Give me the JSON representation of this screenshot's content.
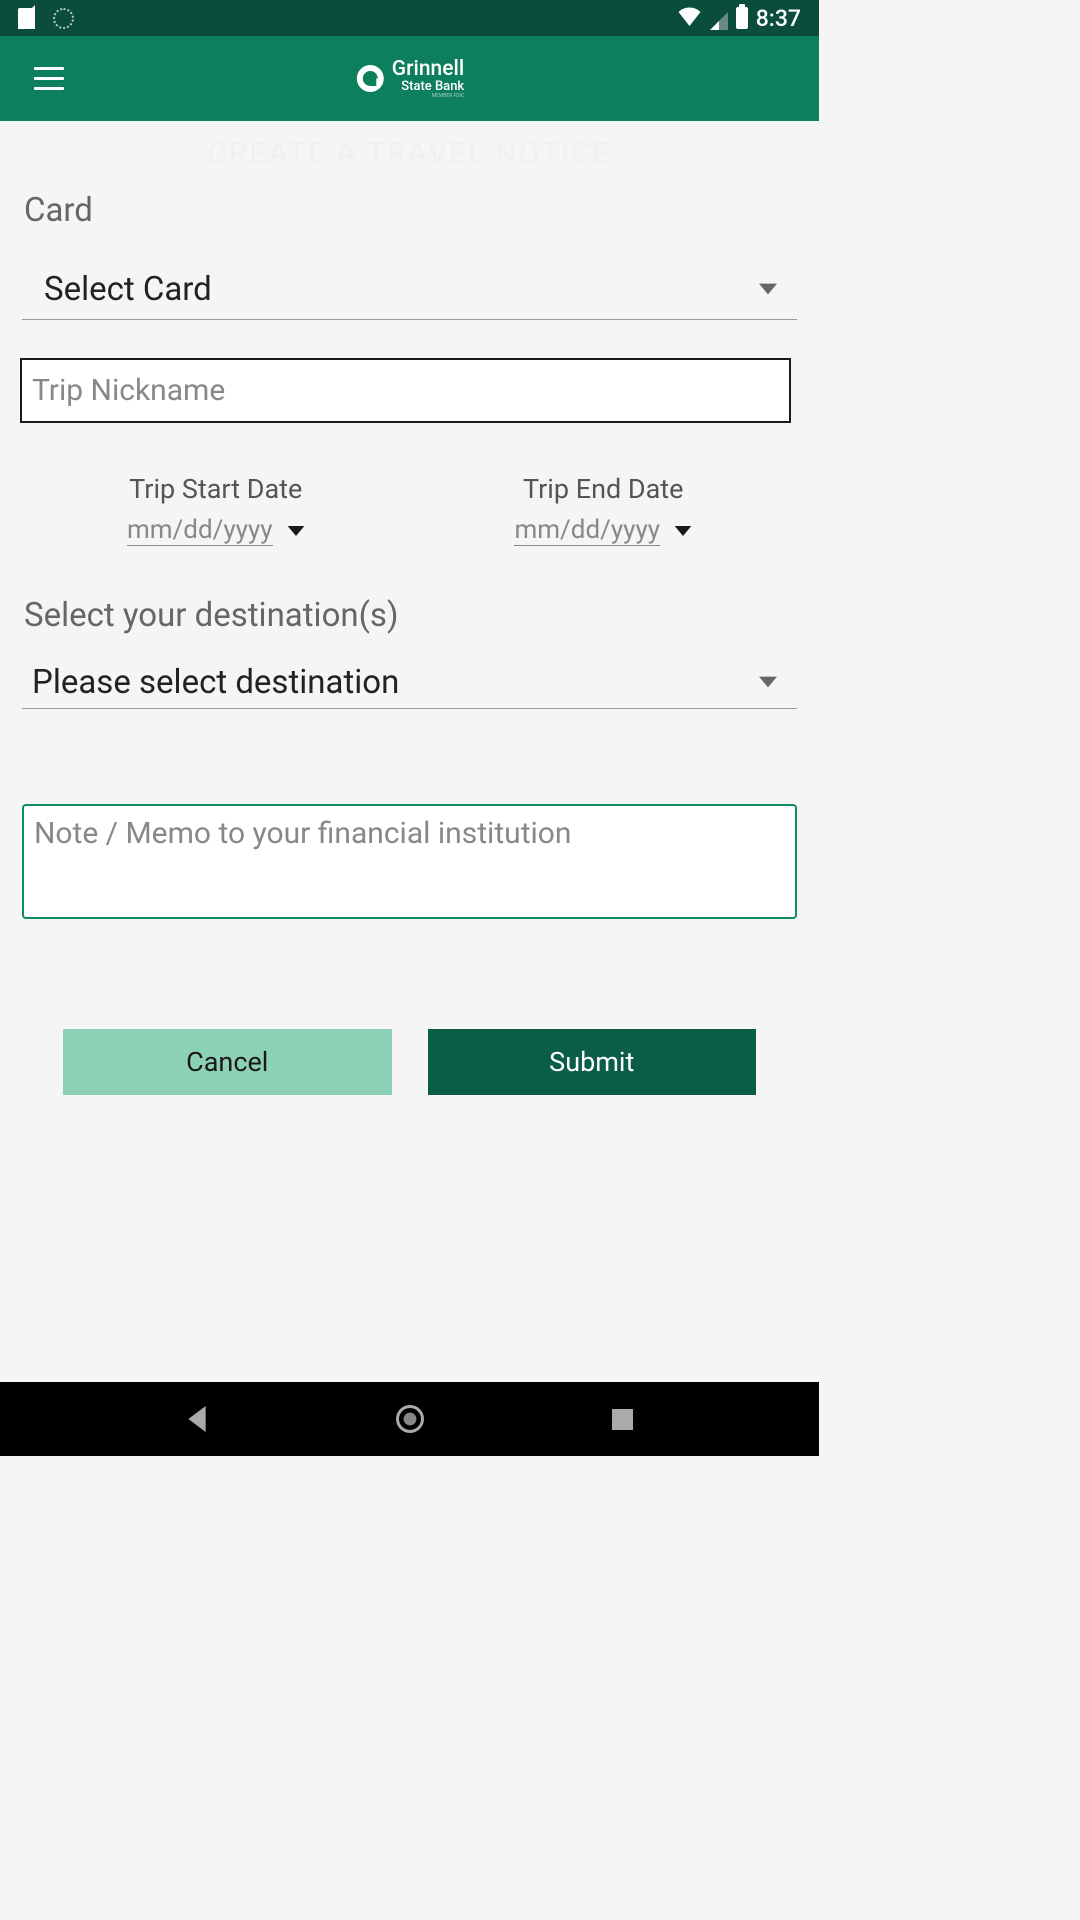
{
  "status_bar": {
    "time": "8:37"
  },
  "header": {
    "brand_line1": "Grinnell",
    "brand_line2": "State Bank",
    "brand_line3": "MEMBER FDIC"
  },
  "page": {
    "title": "CREATE A TRAVEL NOTICE"
  },
  "card_section": {
    "label": "Card",
    "select_placeholder": "Select Card"
  },
  "trip_nickname": {
    "placeholder": "Trip Nickname",
    "value": ""
  },
  "dates": {
    "start_label": "Trip Start Date",
    "start_value": "mm/dd/yyyy",
    "end_label": "Trip End Date",
    "end_value": "mm/dd/yyyy"
  },
  "destination": {
    "label": "Select your destination(s)",
    "select_placeholder": "Please select destination"
  },
  "memo": {
    "placeholder": "Note / Memo to your financial institution",
    "value": ""
  },
  "buttons": {
    "cancel": "Cancel",
    "submit": "Submit"
  },
  "colors": {
    "status_bg": "#0a4d3c",
    "header_bg": "#0e7f5d",
    "accent": "#0e8c64",
    "submit_bg": "#0a5d47",
    "cancel_bg": "#8cd0b5"
  }
}
